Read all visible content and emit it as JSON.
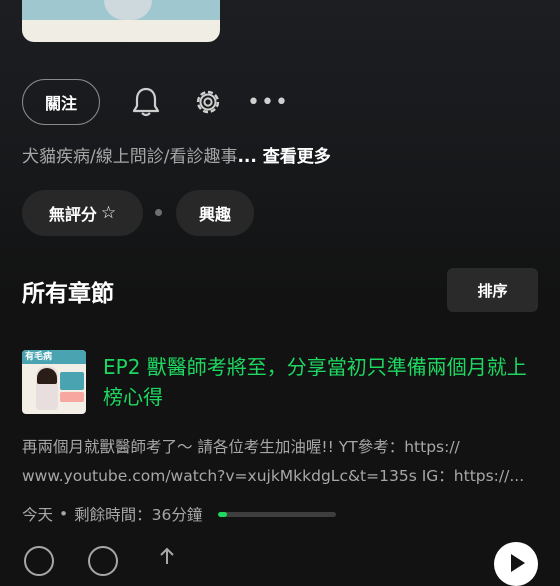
{
  "show": {
    "follow_label": "關注",
    "description": "犬貓疾病/線上問診/看診趣事",
    "see_more_label": "... 查看更多",
    "rating_label": "無評分",
    "rating_star": "☆",
    "interest_label": "興趣"
  },
  "episodes_section": {
    "title": "所有章節",
    "sort_label": "排序"
  },
  "episode": {
    "thumb_tag": "有毛病",
    "title": "EP2 獸醫師考將至，分享當初只準備兩個月就上榜心得",
    "description_line1": "再兩個月就獸醫師考了～ 請各位考生加油喔!! YT參考：https://",
    "description_line2": "www.youtube.com/watch?v=xujkMkkdgLc&t=135s IG：https://...",
    "date": "今天",
    "remaining": "剩餘時間：36分鐘",
    "progress_fraction": 0.08
  },
  "colors": {
    "accent": "#1ed760",
    "background": "#121212",
    "secondary_text": "#a7a7a7"
  },
  "icons": [
    "bell-icon",
    "gear-icon",
    "more-options-icon",
    "star-outline-icon",
    "add-icon",
    "download-icon",
    "share-icon",
    "play-icon"
  ]
}
